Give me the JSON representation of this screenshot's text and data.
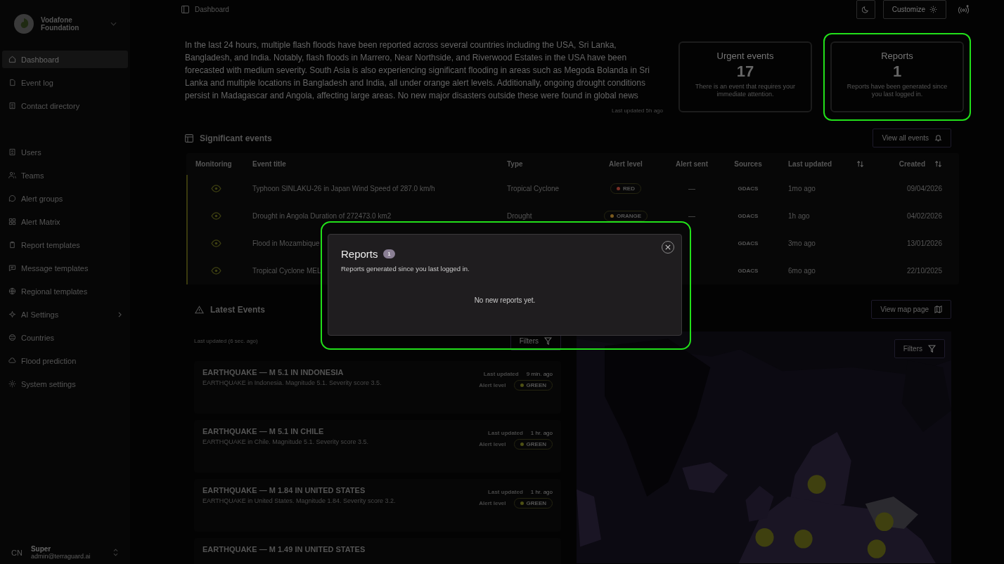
{
  "sidebar": {
    "org": {
      "name": "Vodafone Foundation"
    },
    "sections": [
      {
        "items": [
          {
            "label": "Dashboard",
            "selected": true,
            "has_submenu": false
          },
          {
            "label": "Event log",
            "selected": false,
            "has_submenu": false
          },
          {
            "label": "Contact directory",
            "selected": false,
            "has_submenu": false
          }
        ]
      },
      {
        "items": [
          {
            "label": "Users",
            "selected": false,
            "has_submenu": false
          },
          {
            "label": "Teams",
            "selected": false,
            "has_submenu": false
          },
          {
            "label": "Alert groups",
            "selected": false,
            "has_submenu": false
          },
          {
            "label": "Alert Matrix",
            "selected": false,
            "has_submenu": false
          },
          {
            "label": "Report templates",
            "selected": false,
            "has_submenu": false
          },
          {
            "label": "Message templates",
            "selected": false,
            "has_submenu": false
          },
          {
            "label": "Regional templates",
            "selected": false,
            "has_submenu": false
          },
          {
            "label": "AI Settings",
            "selected": false,
            "has_submenu": true
          },
          {
            "label": "Countries",
            "selected": false,
            "has_submenu": false
          },
          {
            "label": "Flood prediction",
            "selected": false,
            "has_submenu": false
          },
          {
            "label": "System settings",
            "selected": false,
            "has_submenu": false
          }
        ]
      }
    ],
    "user": {
      "initials": "CN",
      "name": "Super",
      "email": "admin@terraguard.ai"
    }
  },
  "header": {
    "breadcrumb": "Dashboard",
    "customize": "Customize"
  },
  "summary": {
    "text": "In the last 24 hours, multiple flash floods have been reported across several countries including the USA, Sri Lanka, Bangladesh, and India. Notably, flash floods in Marrero, Near Northside, and Riverwood Estates in the USA have been forecasted with medium severity. South Asia is also experiencing significant flooding in areas such as Megoda Bolanda in Sri Lanka and multiple locations in Bangladesh and India, all under orange alert levels. Additionally, ongoing drought conditions persist in Madagascar and Angola, affecting large areas. No new major disasters outside these were found in global news",
    "updated": "Last updated 5h ago"
  },
  "stat_cards": [
    {
      "title": "Urgent events",
      "value": "17",
      "caption": "There is an event that requires your immediate attention.",
      "highlighted": false
    },
    {
      "title": "Reports",
      "value": "1",
      "caption": "Reports have been generated since you last logged in.",
      "highlighted": true
    }
  ],
  "significant": {
    "title": "Significant events",
    "button": "View all events",
    "columns": [
      {
        "label": "Monitoring",
        "sortable": false
      },
      {
        "label": "Event title",
        "sortable": false
      },
      {
        "label": "Type",
        "sortable": false
      },
      {
        "label": "Alert level",
        "sortable": false
      },
      {
        "label": "Alert sent",
        "sortable": false
      },
      {
        "label": "Sources",
        "sortable": false
      },
      {
        "label": "Last updated",
        "sortable": true
      },
      {
        "label": "Created",
        "sortable": true
      }
    ],
    "rows": [
      {
        "monitoring": true,
        "title": "Typhoon SINLAKU-26 in Japan Wind Speed of 287.0 km/h",
        "type": "Tropical Cyclone",
        "alert": {
          "label": "RED",
          "color": "#7a2f26"
        },
        "alert_sent": "—",
        "source": "GDACS",
        "updated": "1mo ago",
        "created": "09/04/2026"
      },
      {
        "monitoring": true,
        "title": "Drought in Angola Duration of 272473.0 km2",
        "type": "Drought",
        "alert": {
          "label": "ORANGE",
          "color": "#7a5a1e"
        },
        "alert_sent": "—",
        "source": "GDACS",
        "updated": "1h ago",
        "created": "04/02/2026"
      },
      {
        "monitoring": true,
        "title": "Flood in Mozambique",
        "source": "GDACS",
        "updated": "3mo ago",
        "created": "13/01/2026"
      },
      {
        "monitoring": true,
        "title": "Tropical Cyclone MEL",
        "source": "GDACS",
        "updated": "6mo ago",
        "created": "22/10/2025"
      }
    ]
  },
  "latest": {
    "title": "Latest Events",
    "map_button": "View map page",
    "updated": "Last updated (6 sec. ago)",
    "filters": "Filters",
    "events": [
      {
        "title": "EARTHQUAKE — M 5.1 IN INDONESIA",
        "description": "EARTHQUAKE in Indonesia. Magnitude 5.1. Severity score 3.5.",
        "updated_label": "Last updated",
        "updated": "9 min. ago",
        "alert_label": "Alert level",
        "alert": {
          "label": "GREEN",
          "color": "#4d5014"
        }
      },
      {
        "title": "EARTHQUAKE — M 5.1 IN CHILE",
        "description": "EARTHQUAKE in Chile. Magnitude 5.1. Severity score 3.5.",
        "updated_label": "Last updated",
        "updated": "1 hr. ago",
        "alert_label": "Alert level",
        "alert": {
          "label": "GREEN",
          "color": "#4d5014"
        }
      },
      {
        "title": "EARTHQUAKE — M 1.84 IN UNITED STATES",
        "description": "EARTHQUAKE in United States. Magnitude 1.84. Severity score 3.2.",
        "updated_label": "Last updated",
        "updated": "1 hr. ago",
        "alert_label": "Alert level",
        "alert": {
          "label": "GREEN",
          "color": "#4d5014"
        }
      },
      {
        "title": "EARTHQUAKE — M 1.49 IN UNITED STATES"
      }
    ]
  },
  "map": {
    "filters": "Filters"
  },
  "modal": {
    "title": "Reports",
    "count": "1",
    "subtitle": "Reports generated since you last logged in.",
    "empty": "No new reports yet.",
    "highlighted": true
  }
}
